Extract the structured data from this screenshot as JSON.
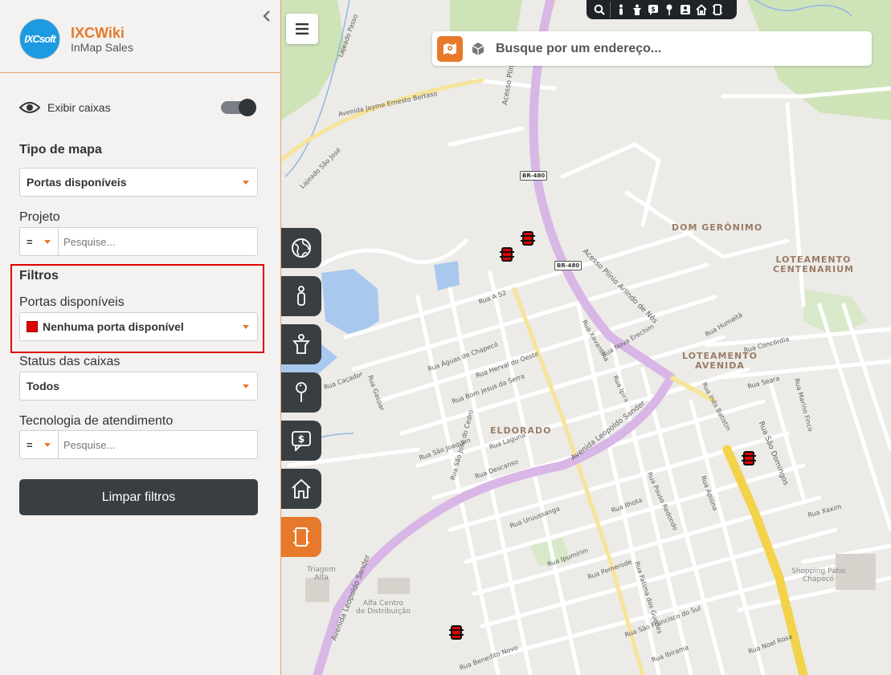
{
  "app": {
    "brand_name": "IXCWiki",
    "brand_sub": "InMap Sales",
    "logo_text": "IXCsoft"
  },
  "sidebar": {
    "show_boxes_label": "Exibir caixas",
    "show_boxes_on": true,
    "map_type_title": "Tipo de mapa",
    "map_type_value": "Portas disponíveis",
    "project_label": "Projeto",
    "project_operator": "=",
    "project_placeholder": "Pesquise...",
    "filters_title": "Filtros",
    "ports_label": "Portas disponíveis",
    "ports_value": "Nenhuma porta disponível",
    "ports_color": "#e00000",
    "status_label": "Status das caixas",
    "status_value": "Todos",
    "tech_label": "Tecnologia de atendimento",
    "tech_operator": "=",
    "tech_placeholder": "Pesquise...",
    "clear_button": "Limpar filtros"
  },
  "search": {
    "placeholder": "Busque por um endereço..."
  },
  "toolbar_icons": [
    "search-icon",
    "person-icon",
    "technician-icon",
    "money-icon",
    "pin-icon",
    "contact-icon",
    "home-icon",
    "box-icon"
  ],
  "rail_icons": [
    "globe-icon",
    "person-icon",
    "technician-icon",
    "pin-icon",
    "money-chat-icon",
    "home-icon",
    "box-icon"
  ],
  "colors": {
    "accent": "#e7792b",
    "dark": "#393e42",
    "marker": "#e00000"
  },
  "map": {
    "districts": [
      "DOM GERÔNIMO",
      "LOTEAMENTO\nCENTENARIUM",
      "LOTEAMENTO\nAVENIDA",
      "ELDORADO"
    ],
    "places": [
      "Triagem\nAlfa",
      "Alfa Centro\nde Distribuição",
      "Shopping Pátio\nChapecó"
    ],
    "shields": [
      "BR-480",
      "BR-480"
    ],
    "streets": [
      "Avenida Jayme Ernesto Bertaso",
      "Acesso Plínio Arlindo",
      "Acesso Plínio Arlindo de Nês",
      "Avenida Leopoldo Sander",
      "Avenida Leopoldo Sander",
      "Rua São Domingos",
      "Rua Fatima dos Guedes",
      "Rua Águas de Chapecó",
      "Rua Herval do Oeste",
      "Rua Bom Jesus da Serra",
      "Rua São Joaquim",
      "Rua Laguna",
      "Rua Descanso",
      "Rua Uruussanga",
      "Rua Ipumirim",
      "Rua Pomerode",
      "Rua Benedito Novo",
      "Rua São Francisco do Sul",
      "Rua Xaxim",
      "Rua Seara",
      "Rua Concórdia",
      "Rua Humaitá",
      "Rua A 52",
      "Rua Caçador",
      "Rua Gaspar",
      "Rua Xavantina",
      "Rua Nova Erechim",
      "Rua Ipira",
      "Rua São José do Cedro",
      "Rua Ilhota",
      "Rua Pouso Redondo",
      "Rua Apiúna",
      "Rua Ibirama",
      "Rua Noel Rosa",
      "Rua Marino Finco",
      "Rua Inês Batistin",
      "Lajeado São José",
      "Lajeado Passo"
    ]
  }
}
